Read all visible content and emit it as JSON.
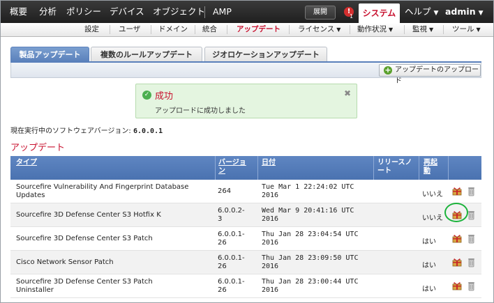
{
  "topnav": {
    "items": [
      "概要",
      "分析",
      "ポリシー",
      "デバイス",
      "オブジェクト",
      "AMP"
    ],
    "expand_label": "展開",
    "alert_count": "1",
    "system_label": "システム",
    "help_label": "ヘルプ",
    "user_label": "admin"
  },
  "subnav": {
    "items": [
      "設定",
      "ユーザ",
      "ドメイン",
      "統合",
      "アップデート",
      "ライセンス",
      "動作状況",
      "監視",
      "ツール"
    ],
    "active": "アップデート"
  },
  "tabs": [
    "製品アップデート",
    "複数のルールアップデート",
    "ジオロケーションアップデート"
  ],
  "upload_label": "アップデートのアップロード",
  "message": {
    "title": "成功",
    "body": "アップロードに成功しました"
  },
  "version": {
    "label": "現在実行中のソフトウェアバージョン:",
    "value": "6.0.0.1"
  },
  "section_title": "アップデート",
  "table": {
    "headers": {
      "type": "タイプ",
      "version_1": "バージョ",
      "version_2": "ン",
      "date": "日付",
      "notes_1": "リリースノ",
      "notes_2": "ート",
      "reboot_1": "再起",
      "reboot_2": "動"
    },
    "rows": [
      {
        "type_1": "Sourcefire Vulnerability And Fingerprint Database",
        "type_2": "Updates",
        "ver_1": "264",
        "ver_2": "",
        "date_1": "Tue Mar 1 22:24:02 UTC",
        "date_2": "2016",
        "reboot": "いいえ"
      },
      {
        "type_1": "Sourcefire 3D Defense Center S3 Hotfix K",
        "type_2": "",
        "ver_1": "6.0.0.2-",
        "ver_2": "3",
        "date_1": "Wed Mar 9 20:41:16 UTC",
        "date_2": "2016",
        "reboot": "いいえ"
      },
      {
        "type_1": "Sourcefire 3D Defense Center S3 Patch",
        "type_2": "",
        "ver_1": "6.0.0.1-",
        "ver_2": "26",
        "date_1": "Thu Jan 28 23:04:54 UTC",
        "date_2": "2016",
        "reboot": "はい"
      },
      {
        "type_1": "Cisco Network Sensor Patch",
        "type_2": "",
        "ver_1": "6.0.0.1-",
        "ver_2": "26",
        "date_1": "Thu Jan 28 23:09:50 UTC",
        "date_2": "2016",
        "reboot": "はい"
      },
      {
        "type_1": "Sourcefire 3D Defense Center S3 Patch",
        "type_2": "Uninstaller",
        "ver_1": "6.0.0.1-",
        "ver_2": "26",
        "date_1": "Thu Jan 28 23:00:44 UTC",
        "date_2": "2016",
        "reboot": "はい"
      }
    ]
  },
  "colors": {
    "accent": "#c8102e",
    "table_header": "#5a80bb",
    "success_bg": "#e4f5e0",
    "highlight": "#1ab33a"
  }
}
